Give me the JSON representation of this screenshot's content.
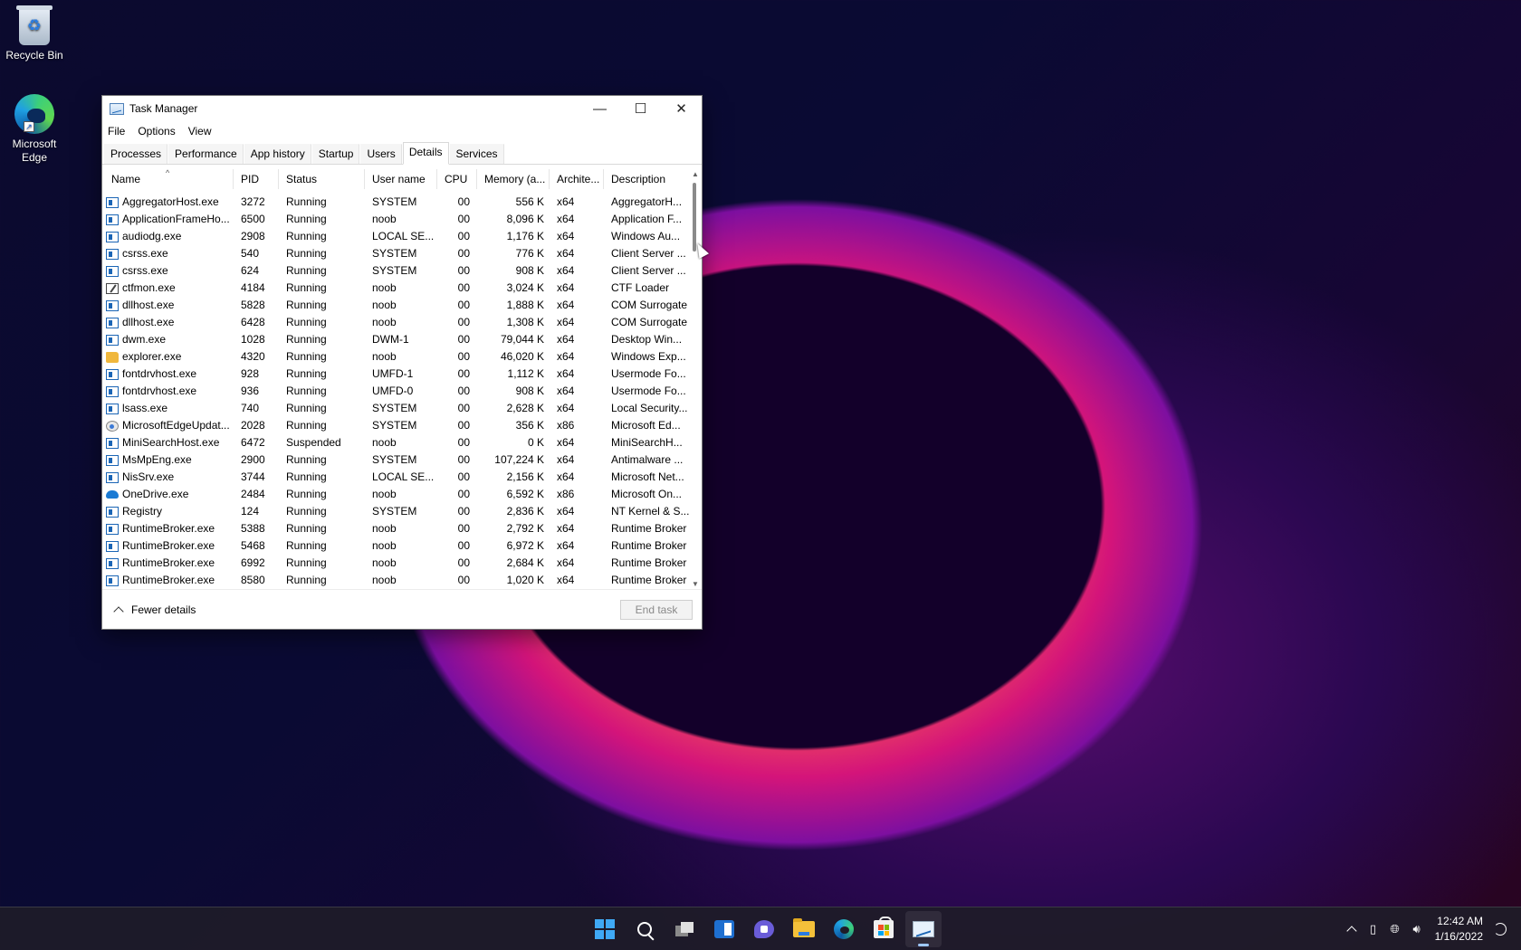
{
  "desktop": {
    "icons": [
      {
        "label": "Recycle Bin",
        "icon": "recycle-bin-icon"
      },
      {
        "label": "Microsoft Edge",
        "icon": "edge-icon"
      }
    ]
  },
  "window": {
    "title": "Task Manager",
    "menu": [
      "File",
      "Options",
      "View"
    ],
    "tabs": [
      "Processes",
      "Performance",
      "App history",
      "Startup",
      "Users",
      "Details",
      "Services"
    ],
    "active_tab": "Details",
    "columns": [
      "Name",
      "PID",
      "Status",
      "User name",
      "CPU",
      "Memory (a...",
      "Archite...",
      "Description"
    ],
    "rows": [
      {
        "icon": "app",
        "name": "AggregatorHost.exe",
        "pid": "3272",
        "status": "Running",
        "user": "SYSTEM",
        "cpu": "00",
        "mem": "556 K",
        "arch": "x64",
        "desc": "AggregatorH..."
      },
      {
        "icon": "app",
        "name": "ApplicationFrameHo...",
        "pid": "6500",
        "status": "Running",
        "user": "noob",
        "cpu": "00",
        "mem": "8,096 K",
        "arch": "x64",
        "desc": "Application F..."
      },
      {
        "icon": "app",
        "name": "audiodg.exe",
        "pid": "2908",
        "status": "Running",
        "user": "LOCAL SE...",
        "cpu": "00",
        "mem": "1,176 K",
        "arch": "x64",
        "desc": "Windows Au..."
      },
      {
        "icon": "app",
        "name": "csrss.exe",
        "pid": "540",
        "status": "Running",
        "user": "SYSTEM",
        "cpu": "00",
        "mem": "776 K",
        "arch": "x64",
        "desc": "Client Server ..."
      },
      {
        "icon": "app",
        "name": "csrss.exe",
        "pid": "624",
        "status": "Running",
        "user": "SYSTEM",
        "cpu": "00",
        "mem": "908 K",
        "arch": "x64",
        "desc": "Client Server ..."
      },
      {
        "icon": "pen",
        "name": "ctfmon.exe",
        "pid": "4184",
        "status": "Running",
        "user": "noob",
        "cpu": "00",
        "mem": "3,024 K",
        "arch": "x64",
        "desc": "CTF Loader"
      },
      {
        "icon": "app",
        "name": "dllhost.exe",
        "pid": "5828",
        "status": "Running",
        "user": "noob",
        "cpu": "00",
        "mem": "1,888 K",
        "arch": "x64",
        "desc": "COM Surrogate"
      },
      {
        "icon": "app",
        "name": "dllhost.exe",
        "pid": "6428",
        "status": "Running",
        "user": "noob",
        "cpu": "00",
        "mem": "1,308 K",
        "arch": "x64",
        "desc": "COM Surrogate"
      },
      {
        "icon": "app",
        "name": "dwm.exe",
        "pid": "1028",
        "status": "Running",
        "user": "DWM-1",
        "cpu": "00",
        "mem": "79,044 K",
        "arch": "x64",
        "desc": "Desktop Win..."
      },
      {
        "icon": "folder",
        "name": "explorer.exe",
        "pid": "4320",
        "status": "Running",
        "user": "noob",
        "cpu": "00",
        "mem": "46,020 K",
        "arch": "x64",
        "desc": "Windows Exp..."
      },
      {
        "icon": "app",
        "name": "fontdrvhost.exe",
        "pid": "928",
        "status": "Running",
        "user": "UMFD-1",
        "cpu": "00",
        "mem": "1,112 K",
        "arch": "x64",
        "desc": "Usermode Fo..."
      },
      {
        "icon": "app",
        "name": "fontdrvhost.exe",
        "pid": "936",
        "status": "Running",
        "user": "UMFD-0",
        "cpu": "00",
        "mem": "908 K",
        "arch": "x64",
        "desc": "Usermode Fo..."
      },
      {
        "icon": "app",
        "name": "lsass.exe",
        "pid": "740",
        "status": "Running",
        "user": "SYSTEM",
        "cpu": "00",
        "mem": "2,628 K",
        "arch": "x64",
        "desc": "Local Security..."
      },
      {
        "icon": "upd",
        "name": "MicrosoftEdgeUpdat...",
        "pid": "2028",
        "status": "Running",
        "user": "SYSTEM",
        "cpu": "00",
        "mem": "356 K",
        "arch": "x86",
        "desc": "Microsoft Ed..."
      },
      {
        "icon": "app",
        "name": "MiniSearchHost.exe",
        "pid": "6472",
        "status": "Suspended",
        "user": "noob",
        "cpu": "00",
        "mem": "0 K",
        "arch": "x64",
        "desc": "MiniSearchH..."
      },
      {
        "icon": "app",
        "name": "MsMpEng.exe",
        "pid": "2900",
        "status": "Running",
        "user": "SYSTEM",
        "cpu": "00",
        "mem": "107,224 K",
        "arch": "x64",
        "desc": "Antimalware ..."
      },
      {
        "icon": "app",
        "name": "NisSrv.exe",
        "pid": "3744",
        "status": "Running",
        "user": "LOCAL SE...",
        "cpu": "00",
        "mem": "2,156 K",
        "arch": "x64",
        "desc": "Microsoft Net..."
      },
      {
        "icon": "cloud",
        "name": "OneDrive.exe",
        "pid": "2484",
        "status": "Running",
        "user": "noob",
        "cpu": "00",
        "mem": "6,592 K",
        "arch": "x86",
        "desc": "Microsoft On..."
      },
      {
        "icon": "app",
        "name": "Registry",
        "pid": "124",
        "status": "Running",
        "user": "SYSTEM",
        "cpu": "00",
        "mem": "2,836 K",
        "arch": "x64",
        "desc": "NT Kernel & S..."
      },
      {
        "icon": "app",
        "name": "RuntimeBroker.exe",
        "pid": "5388",
        "status": "Running",
        "user": "noob",
        "cpu": "00",
        "mem": "2,792 K",
        "arch": "x64",
        "desc": "Runtime Broker"
      },
      {
        "icon": "app",
        "name": "RuntimeBroker.exe",
        "pid": "5468",
        "status": "Running",
        "user": "noob",
        "cpu": "00",
        "mem": "6,972 K",
        "arch": "x64",
        "desc": "Runtime Broker"
      },
      {
        "icon": "app",
        "name": "RuntimeBroker.exe",
        "pid": "6992",
        "status": "Running",
        "user": "noob",
        "cpu": "00",
        "mem": "2,684 K",
        "arch": "x64",
        "desc": "Runtime Broker"
      },
      {
        "icon": "app",
        "name": "RuntimeBroker.exe",
        "pid": "8580",
        "status": "Running",
        "user": "noob",
        "cpu": "00",
        "mem": "1,020 K",
        "arch": "x64",
        "desc": "Runtime Broker"
      }
    ],
    "footer": {
      "fewer_details": "Fewer details",
      "end_task": "End task"
    }
  },
  "taskbar": {
    "apps": [
      "start-icon",
      "search-icon",
      "task-view-icon",
      "widgets-icon",
      "chat-icon",
      "file-explorer-icon",
      "edge-icon",
      "store-icon",
      "task-manager-icon"
    ],
    "time": "12:42 AM",
    "date": "1/16/2022"
  }
}
